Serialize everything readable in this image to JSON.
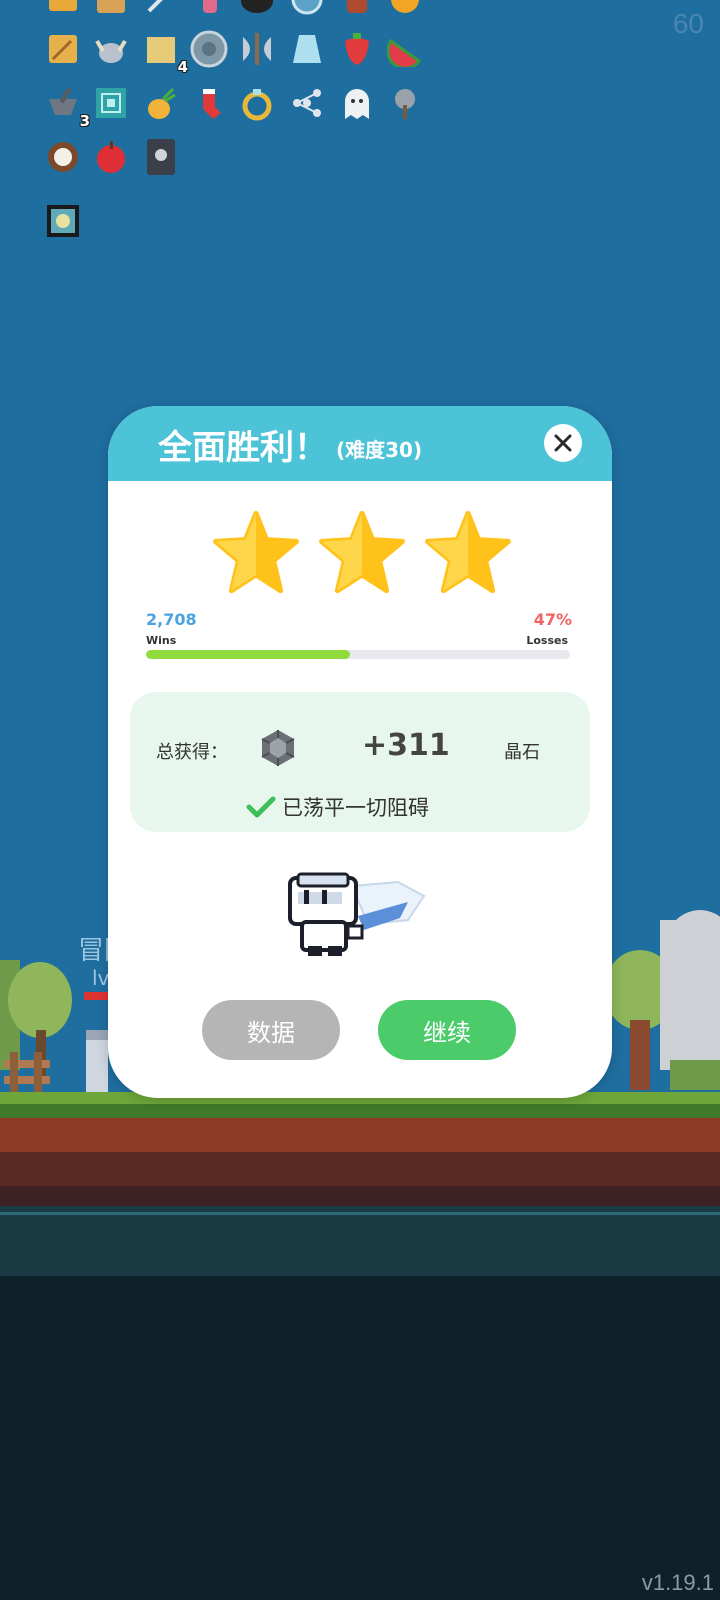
{
  "hud": {
    "fps": "60",
    "version": "v1.19.1"
  },
  "inventory": {
    "items": [
      {
        "icon": "scroll-icon"
      },
      {
        "icon": "parchment-icon"
      },
      {
        "icon": "sword-icon"
      },
      {
        "icon": "potion-icon"
      },
      {
        "icon": "cauldron-icon"
      },
      {
        "icon": "shield-orb-icon"
      },
      {
        "icon": "lantern-icon"
      },
      {
        "icon": "orange-icon"
      },
      {
        "icon": "journal-icon"
      },
      {
        "icon": "viking-helmet-icon"
      },
      {
        "icon": "map-icon",
        "count": "4"
      },
      {
        "icon": "round-shield-icon"
      },
      {
        "icon": "battle-axe-icon"
      },
      {
        "icon": "robe-icon"
      },
      {
        "icon": "strawberry-icon"
      },
      {
        "icon": "watermelon-icon"
      },
      {
        "icon": "mortar-pestle-icon",
        "count": "3"
      },
      {
        "icon": "spiral-rune-icon"
      },
      {
        "icon": "pineapple-icon"
      },
      {
        "icon": "sock-icon"
      },
      {
        "icon": "gold-ring-icon"
      },
      {
        "icon": "molecule-icon"
      },
      {
        "icon": "ghost-icon"
      },
      {
        "icon": "spiked-mace-icon"
      },
      {
        "icon": "coconut-icon"
      },
      {
        "icon": "red-apple-icon"
      },
      {
        "icon": "skull-book-icon"
      },
      {
        "icon": "glowing-gem-icon"
      }
    ]
  },
  "background": {
    "label_top": "冒险",
    "label_lvl": "lv"
  },
  "modal": {
    "title": "全面胜利！",
    "subtitle": "(难度30)",
    "stars": 3,
    "stats": {
      "wins_value": "2,708",
      "wins_label": "Wins",
      "losses_value": "47%",
      "losses_label": "Losses",
      "wins_fraction": 0.48
    },
    "reward": {
      "label": "总获得：",
      "icon": "crystal-gem-icon",
      "amount": "+311",
      "unit": "晶石",
      "status": "已荡平一切阻碍",
      "status_icon": "checkmark-icon"
    },
    "buttons": {
      "stats": "数据",
      "continue": "继续"
    }
  },
  "colors": {
    "sky": "#1f6ea0",
    "header": "#4cc3d7",
    "star": "#ffc21a",
    "wins": "#4aa3e0",
    "losses": "#ef6464",
    "progress": "#8fda3d",
    "reward_bg": "#e8f7ed",
    "continue_button": "#4ccb6a",
    "stats_button": "#b5b5b5"
  }
}
